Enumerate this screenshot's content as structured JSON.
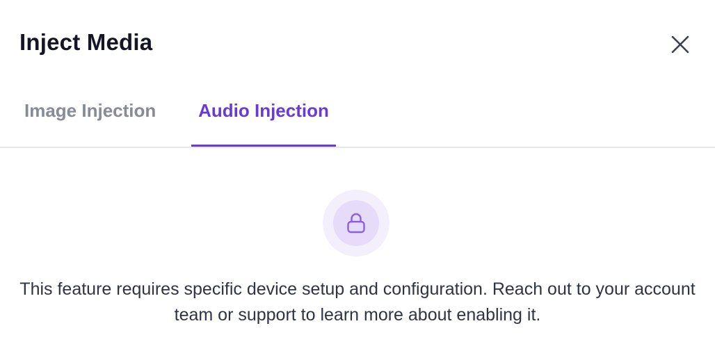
{
  "dialog": {
    "title": "Inject Media",
    "close_icon": "close-icon"
  },
  "tabs": [
    {
      "label": "Image Injection",
      "active": false
    },
    {
      "label": "Audio Injection",
      "active": true
    }
  ],
  "content": {
    "icon": "lock-icon",
    "message": "This feature requires specific device setup and configuration. Reach out to your account team or support to learn more about enabling it."
  },
  "colors": {
    "accent": "#6a3ad6",
    "inactive_tab": "#858b99",
    "title": "#141625",
    "body_text": "#2f3445",
    "icon_bg_outer": "#f4effd",
    "icon_bg_inner": "#e6dcfa"
  }
}
